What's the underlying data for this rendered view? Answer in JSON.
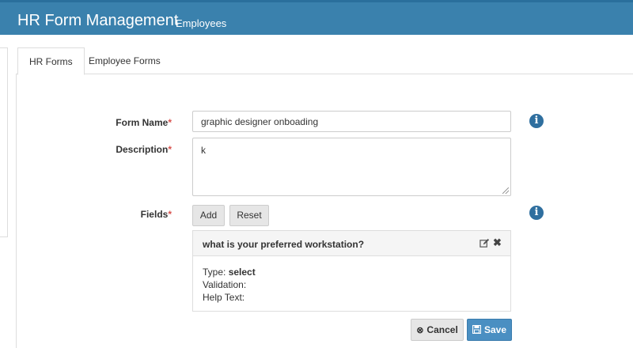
{
  "header": {
    "title": "HR Form Management",
    "subtitle": "Employees"
  },
  "tabs": [
    {
      "label": "HR Forms",
      "active": true
    },
    {
      "label": "Employee Forms",
      "active": false
    }
  ],
  "form": {
    "name_label": "Form Name",
    "name_value": "graphic designer onboading",
    "description_label": "Description",
    "description_value": "k",
    "fields_label": "Fields",
    "required_mark": "*",
    "add_label": "Add",
    "reset_label": "Reset",
    "field_card": {
      "title": "what is your preferred workstation?",
      "type_label": "Type:",
      "type_value": "select",
      "validation_label": "Validation:",
      "help_text_label": "Help Text:"
    },
    "cancel_label": "Cancel",
    "save_label": "Save"
  },
  "icons": {
    "info": "info-circle-icon",
    "edit": "edit-icon",
    "close": "close-icon",
    "cancel": "cancel-circle-icon",
    "save": "floppy-disk-icon"
  },
  "colors": {
    "header": "#3a81ad",
    "required": "#d9534f",
    "info": "#2f6f9f",
    "primary": "#4a8fc2"
  }
}
